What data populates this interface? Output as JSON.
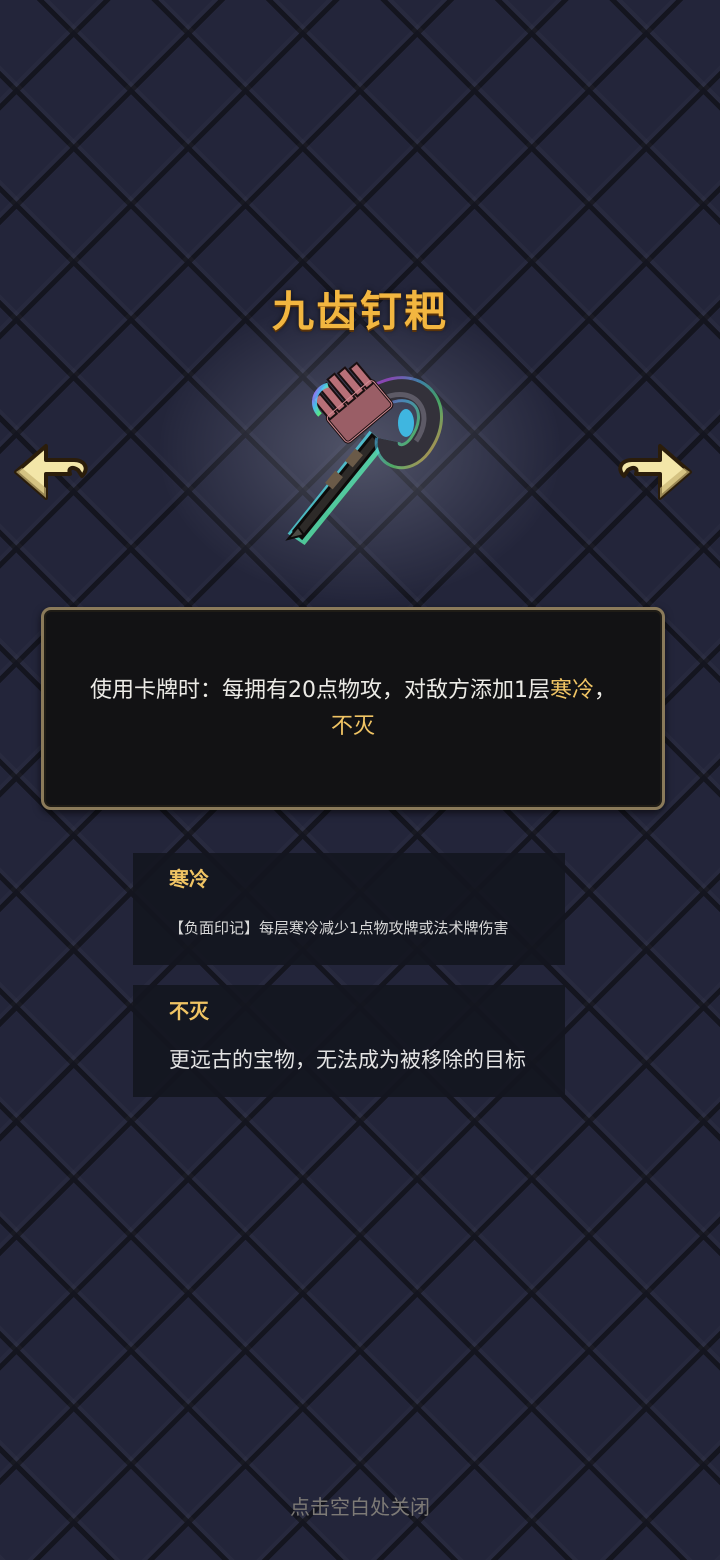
{
  "item": {
    "name": "九齿钉耙",
    "icon": "rake-weapon-icon"
  },
  "navigation": {
    "prev_icon": "arrow-left-icon",
    "next_icon": "arrow-right-icon"
  },
  "description": {
    "prefix": "使用卡牌时：每拥有20点物攻，对敌方添加1层",
    "keyword_cold": "寒冷",
    "separator": "，",
    "keyword_eternal": "不灭"
  },
  "keywords": [
    {
      "title": "寒冷",
      "body": "【负面印记】每层寒冷减少1点物攻牌或法术牌伤害"
    },
    {
      "title": "不灭",
      "body": "更远古的宝物，无法成为被移除的目标"
    }
  ],
  "close_hint": "点击空白处关闭",
  "colors": {
    "title": "#f2b640",
    "keyword": "#f0c464",
    "panel_border": "#8a7a5a",
    "background": "#23253a"
  }
}
